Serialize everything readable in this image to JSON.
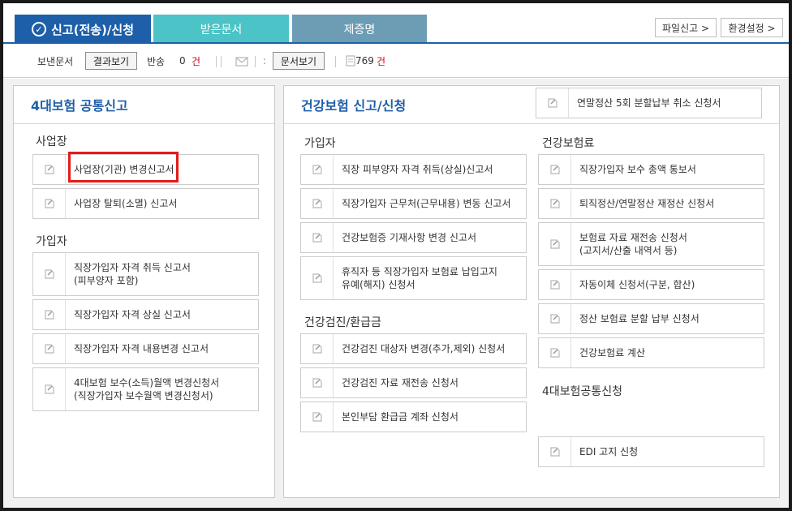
{
  "tabs": {
    "active": "신고(전송)/신청",
    "received": "받은문서",
    "certificate": "제증명"
  },
  "top_buttons": {
    "file_report": "파일신고 >",
    "settings": "환경설정 >"
  },
  "toolbar": {
    "sent_label": "보낸문서",
    "result_btn": "결과보기",
    "returned_label": "반송",
    "returned_count": "0",
    "unit1": "건",
    "colon": ":",
    "doc_btn": "문서보기",
    "doc_count": "769",
    "unit2": "건"
  },
  "left_panel": {
    "title": "4대보험 공통신고",
    "workplace_section": "사업장",
    "workplace_items": [
      "사업장(기관) 변경신고서",
      "사업장 탈퇴(소멸) 신고서"
    ],
    "member_section": "가입자",
    "member_items": [
      "직장가입자 자격 취득 신고서\n(피부양자 포함)",
      "직장가입자 자격 상실 신고서",
      "직장가입자 자격 내용변경 신고서",
      "4대보험 보수(소득)월액 변경신청서\n(직장가입자 보수월액 변경신청서)"
    ]
  },
  "right_panel": {
    "title": "건강보험 신고/신청",
    "top_item": "연말정산 5회 분할납부 취소 신청서",
    "member_section": "가입자",
    "member_items": [
      "직장 피부양자 자격 취득(상실)신고서",
      "직장가입자 근무처(근무내용) 변동 신고서",
      "건강보험증 기재사항 변경 신고서",
      "휴직자 등 직장가입자 보험료 납입고지\n유예(해지) 신청서"
    ],
    "checkup_section": "건강검진/환급금",
    "checkup_items": [
      "건강검진 대상자 변경(추가,제외) 신청서",
      "건강검진 자료 재전송 신청서",
      "본인부담 환급금 계좌 신청서"
    ],
    "premium_section": "건강보험료",
    "premium_items": [
      "직장가입자 보수 총액 통보서",
      "퇴직정산/연말정산 재정산 신청서",
      "보험료 자료 재전송 신청서\n(고지서/산출 내역서 등)",
      "자동이체 신청서(구분, 합산)",
      "정산 보험료 분할 납부 신청서",
      "건강보험료 계산"
    ],
    "common_section": "4대보험공통신청",
    "common_items": [
      "EDI 고지 신청"
    ]
  }
}
